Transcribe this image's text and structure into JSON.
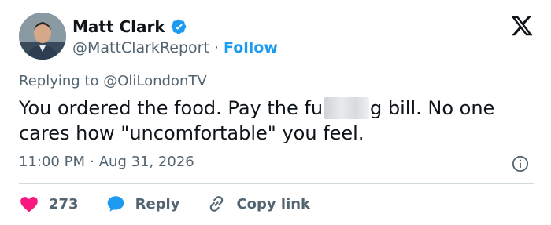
{
  "author": {
    "name": "Matt Clark",
    "handle": "@MattClarkReport",
    "separator": "·",
    "follow_label": "Follow"
  },
  "tweet": {
    "replying_prefix": "Replying to ",
    "replying_handle": "@OliLondonTV",
    "text_part1": "You ordered the food. Pay the fu",
    "text_part2": "g bill. No one cares how \"uncomfortable\" you feel.",
    "time": "11:00 PM",
    "meta_separator": "·",
    "date": "Aug 31, 2026"
  },
  "actions": {
    "like_count": "273",
    "reply_label": "Reply",
    "copy_label": "Copy link"
  },
  "colors": {
    "accent": "#1d9bf0",
    "like": "#f91880",
    "muted": "#536471",
    "text": "#0f1419"
  }
}
